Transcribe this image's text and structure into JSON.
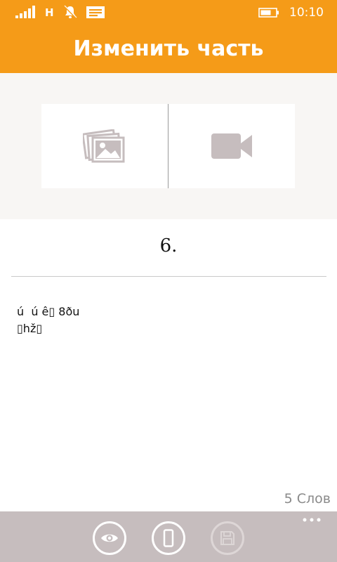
{
  "status_bar": {
    "network_label": "H",
    "time": "10:10"
  },
  "header": {
    "title": "Изменить часть"
  },
  "media": {
    "photo_icon": "image-gallery-icon",
    "video_icon": "video-camera-icon"
  },
  "part": {
    "title": "6.",
    "body": "ú  ú ê▯ 8ðu\n▯hž▯",
    "word_count": "5 Слов"
  },
  "app_bar": {
    "buttons": [
      "eye-icon",
      "phone-icon",
      "save-icon"
    ],
    "more": "more-icon"
  },
  "colors": {
    "accent": "#f59b18",
    "app_bar": "#c6bdbe",
    "media_background": "#f8f6f4"
  }
}
